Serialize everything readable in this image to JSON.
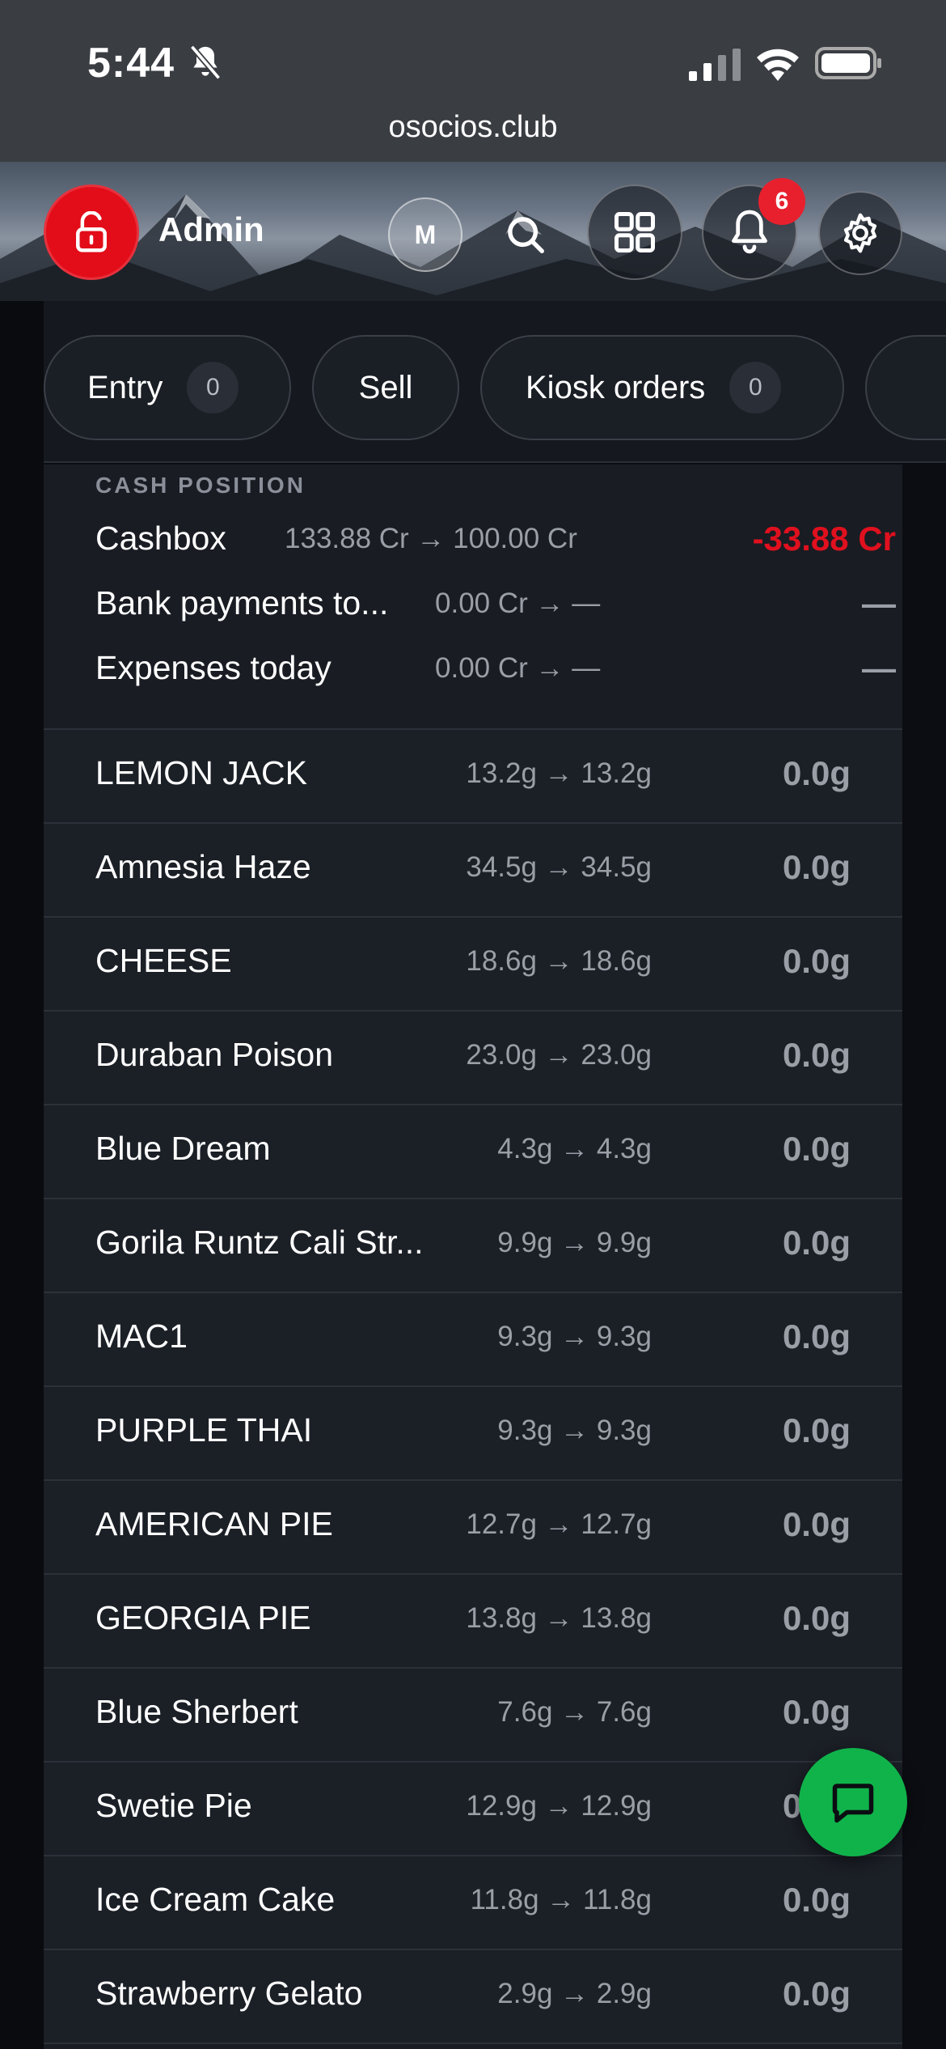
{
  "status_bar": {
    "time": "5:44",
    "url": "osocios.club",
    "icons": [
      "bell-slash-icon",
      "cellular-signal-icon",
      "wifi-icon",
      "battery-icon"
    ]
  },
  "header": {
    "user_label": "Admin",
    "avatar_initial": "M",
    "notification_count": "6",
    "icons": [
      "unlock-icon",
      "search-icon",
      "grid-icon",
      "bell-icon",
      "gear-icon"
    ]
  },
  "tabs": [
    {
      "label": "Entry",
      "count": "0"
    },
    {
      "label": "Sell"
    },
    {
      "label": "Kiosk orders",
      "count": "0"
    }
  ],
  "cash_position": {
    "label": "CASH POSITION",
    "rows": [
      {
        "name": "Cashbox",
        "change": "133.88 Cr → 100.00 Cr",
        "delta": "-33.88 Cr"
      },
      {
        "name": "Bank payments to...",
        "change": "0.00 Cr → —",
        "delta": "—"
      },
      {
        "name": "Expenses today",
        "change": "0.00 Cr → —",
        "delta": "—"
      }
    ]
  },
  "products": [
    {
      "name": "LEMON JACK",
      "change": "13.2g → 13.2g",
      "delta": "0.0g"
    },
    {
      "name": "Amnesia Haze",
      "change": "34.5g → 34.5g",
      "delta": "0.0g"
    },
    {
      "name": "CHEESE",
      "change": "18.6g → 18.6g",
      "delta": "0.0g"
    },
    {
      "name": "Duraban Poison",
      "change": "23.0g → 23.0g",
      "delta": "0.0g"
    },
    {
      "name": "Blue Dream",
      "change": "4.3g → 4.3g",
      "delta": "0.0g"
    },
    {
      "name": "Gorila Runtz Cali Str...",
      "change": "9.9g → 9.9g",
      "delta": "0.0g"
    },
    {
      "name": "MAC1",
      "change": "9.3g → 9.3g",
      "delta": "0.0g"
    },
    {
      "name": "PURPLE THAI",
      "change": "9.3g → 9.3g",
      "delta": "0.0g"
    },
    {
      "name": "AMERICAN PIE",
      "change": "12.7g → 12.7g",
      "delta": "0.0g"
    },
    {
      "name": "GEORGIA PIE",
      "change": "13.8g → 13.8g",
      "delta": "0.0g"
    },
    {
      "name": "Blue Sherbert",
      "change": "7.6g → 7.6g",
      "delta": "0.0g"
    },
    {
      "name": "Swetie Pie",
      "change": "12.9g → 12.9g",
      "delta": "0.0g"
    },
    {
      "name": "Ice Cream Cake",
      "change": "11.8g → 11.8g",
      "delta": "0.0g"
    },
    {
      "name": "Strawberry Gelato",
      "change": "2.9g → 2.9g",
      "delta": "0.0g"
    }
  ],
  "colors": {
    "accent_red": "#e30d1a",
    "negative": "#e0101e",
    "chat_green": "#10b34a",
    "background": "#191c23"
  },
  "fab": {
    "icon": "chat-bubble-icon"
  }
}
